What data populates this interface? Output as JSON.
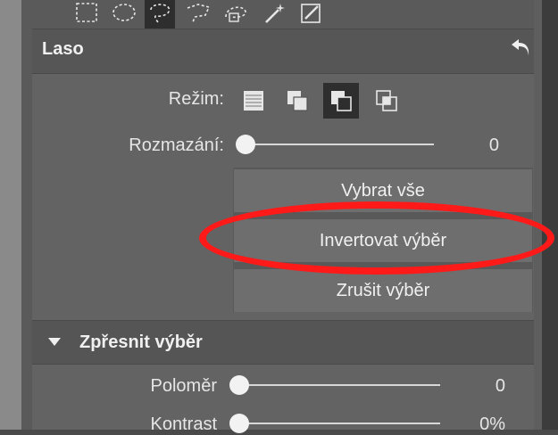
{
  "toolbar": {
    "tools": [
      {
        "icon": "rectangle-select-icon",
        "active": false
      },
      {
        "icon": "ellipse-select-icon",
        "active": false
      },
      {
        "icon": "lasso-icon",
        "active": true
      },
      {
        "icon": "polygon-lasso-icon",
        "active": false
      },
      {
        "icon": "magnetic-lasso-icon",
        "active": false
      },
      {
        "icon": "magic-wand-icon",
        "active": false
      },
      {
        "icon": "brush-select-icon",
        "active": false
      }
    ]
  },
  "panel": {
    "title": "Laso",
    "undo_icon": "undo-icon",
    "mode": {
      "label": "Režim:",
      "options": [
        {
          "icon": "new-selection-icon",
          "active": false
        },
        {
          "icon": "add-selection-icon",
          "active": false
        },
        {
          "icon": "subtract-selection-icon",
          "active": true
        },
        {
          "icon": "intersect-selection-icon",
          "active": false
        }
      ]
    },
    "blur": {
      "label": "Rozmazání:",
      "value": "0",
      "level": 0
    },
    "actions": {
      "select_all": "Vybrat vše",
      "invert": "Invertovat výběr",
      "deselect": "Zrušit výběr"
    },
    "highlight_color": "#ff1a1a"
  },
  "refine": {
    "title": "Zpřesnit výběr",
    "radius": {
      "label": "Poloměr",
      "value": "0",
      "level": 0
    },
    "contrast": {
      "label": "Kontrast",
      "value": "0%",
      "level": 0
    }
  }
}
